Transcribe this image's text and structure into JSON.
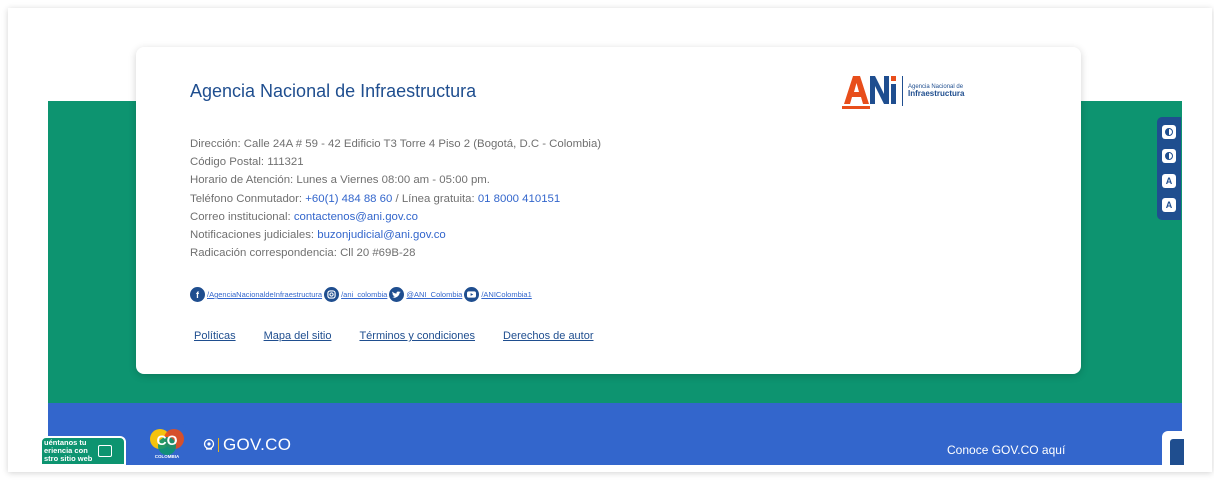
{
  "card": {
    "title": "Agencia Nacional de Infraestructura",
    "logo": {
      "mark": "ANi",
      "line1": "Agencia Nacional de",
      "line2": "Infraestructura"
    },
    "info": {
      "address": "Dirección: Calle 24A # 59 - 42 Edificio T3 Torre 4 Piso 2 (Bogotá, D.C - Colombia)",
      "postal": "Código Postal: 111321",
      "hours": "Horario de Atención: Lunes a Viernes 08:00 am - 05:00 pm.",
      "phone_label": "Teléfono Conmutador: ",
      "phone_value": "+60(1) 484 88 60",
      "free_label": " / Línea gratuita: ",
      "free_value": "01 8000 410151",
      "email_label": "Correo institucional: ",
      "email_value": "contactenos@ani.gov.co",
      "judicial_label": "Notificaciones judiciales: ",
      "judicial_value": "buzonjudicial@ani.gov.co",
      "correspondence": "Radicación correspondencia: Cll 20 #69B-28"
    },
    "social": {
      "facebook": "/AgenciaNacionaldeInfraestructura",
      "instagram": "/ani_colombia",
      "twitter": "@ANI_Colombia",
      "youtube": "/ANIColombia1"
    },
    "links": {
      "policies": "Políticas",
      "sitemap": "Mapa del sitio",
      "terms": "Términos y condiciones",
      "copyright": "Derechos de autor"
    }
  },
  "accessibility": {
    "font_up": "A",
    "font_down": "A"
  },
  "footer": {
    "feedback_text": "uéntanos tu\neriencia con\nstro sitio web",
    "co_logo_text": "CO",
    "co_logo_sub": "COLOMBIA",
    "govco_text": "GOV.CO",
    "conoce_text": "Conoce GOV.CO aquí"
  },
  "colors": {
    "green": "#0d9470",
    "blue": "#3366cc",
    "navy": "#1f4e8f",
    "ani_orange": "#e84e1b"
  }
}
